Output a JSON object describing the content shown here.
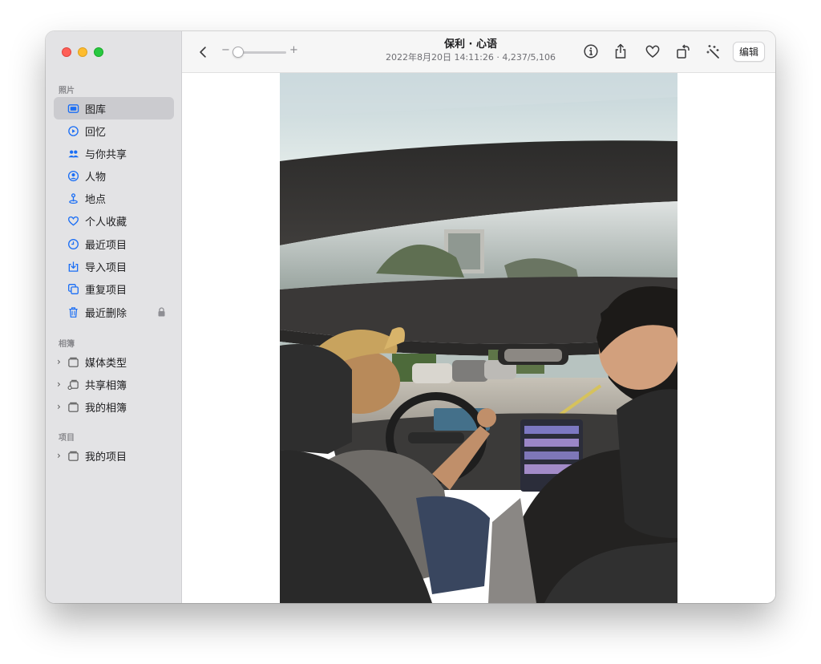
{
  "sidebar": {
    "section_photos": "照片",
    "items": [
      {
        "label": "图库",
        "icon": "photo-library-icon"
      },
      {
        "label": "回忆",
        "icon": "memories-icon"
      },
      {
        "label": "与你共享",
        "icon": "shared-with-you-icon"
      },
      {
        "label": "人物",
        "icon": "people-icon"
      },
      {
        "label": "地点",
        "icon": "places-icon"
      },
      {
        "label": "个人收藏",
        "icon": "heart-icon"
      },
      {
        "label": "最近项目",
        "icon": "clock-icon"
      },
      {
        "label": "导入项目",
        "icon": "import-icon"
      },
      {
        "label": "重复项目",
        "icon": "duplicates-icon"
      },
      {
        "label": "最近删除",
        "icon": "trash-icon"
      }
    ],
    "section_albums": "相簿",
    "albums": [
      {
        "label": "媒体类型",
        "icon": "folder-icon"
      },
      {
        "label": "共享相簿",
        "icon": "shared-album-icon"
      },
      {
        "label": "我的相簿",
        "icon": "folder-icon"
      }
    ],
    "section_projects": "项目",
    "projects": [
      {
        "label": "我的项目",
        "icon": "folder-icon"
      }
    ]
  },
  "toolbar": {
    "zoom_minus": "−",
    "zoom_plus": "+",
    "title": "保利 · 心语",
    "subtitle": "2022年8月20日 14:11:26 · 4,237/5,106",
    "edit_label": "编辑",
    "icons": [
      "info-icon",
      "share-icon",
      "heart-icon",
      "rotate-icon",
      "auto-enhance-icon"
    ]
  },
  "colors": {
    "close": "#fe5f57",
    "minimize": "#febc2e",
    "maximize": "#28c840",
    "accent": "#1a6ef5",
    "sidebar_bg": "#e3e3e5",
    "selected_bg": "#cbcbcf"
  }
}
